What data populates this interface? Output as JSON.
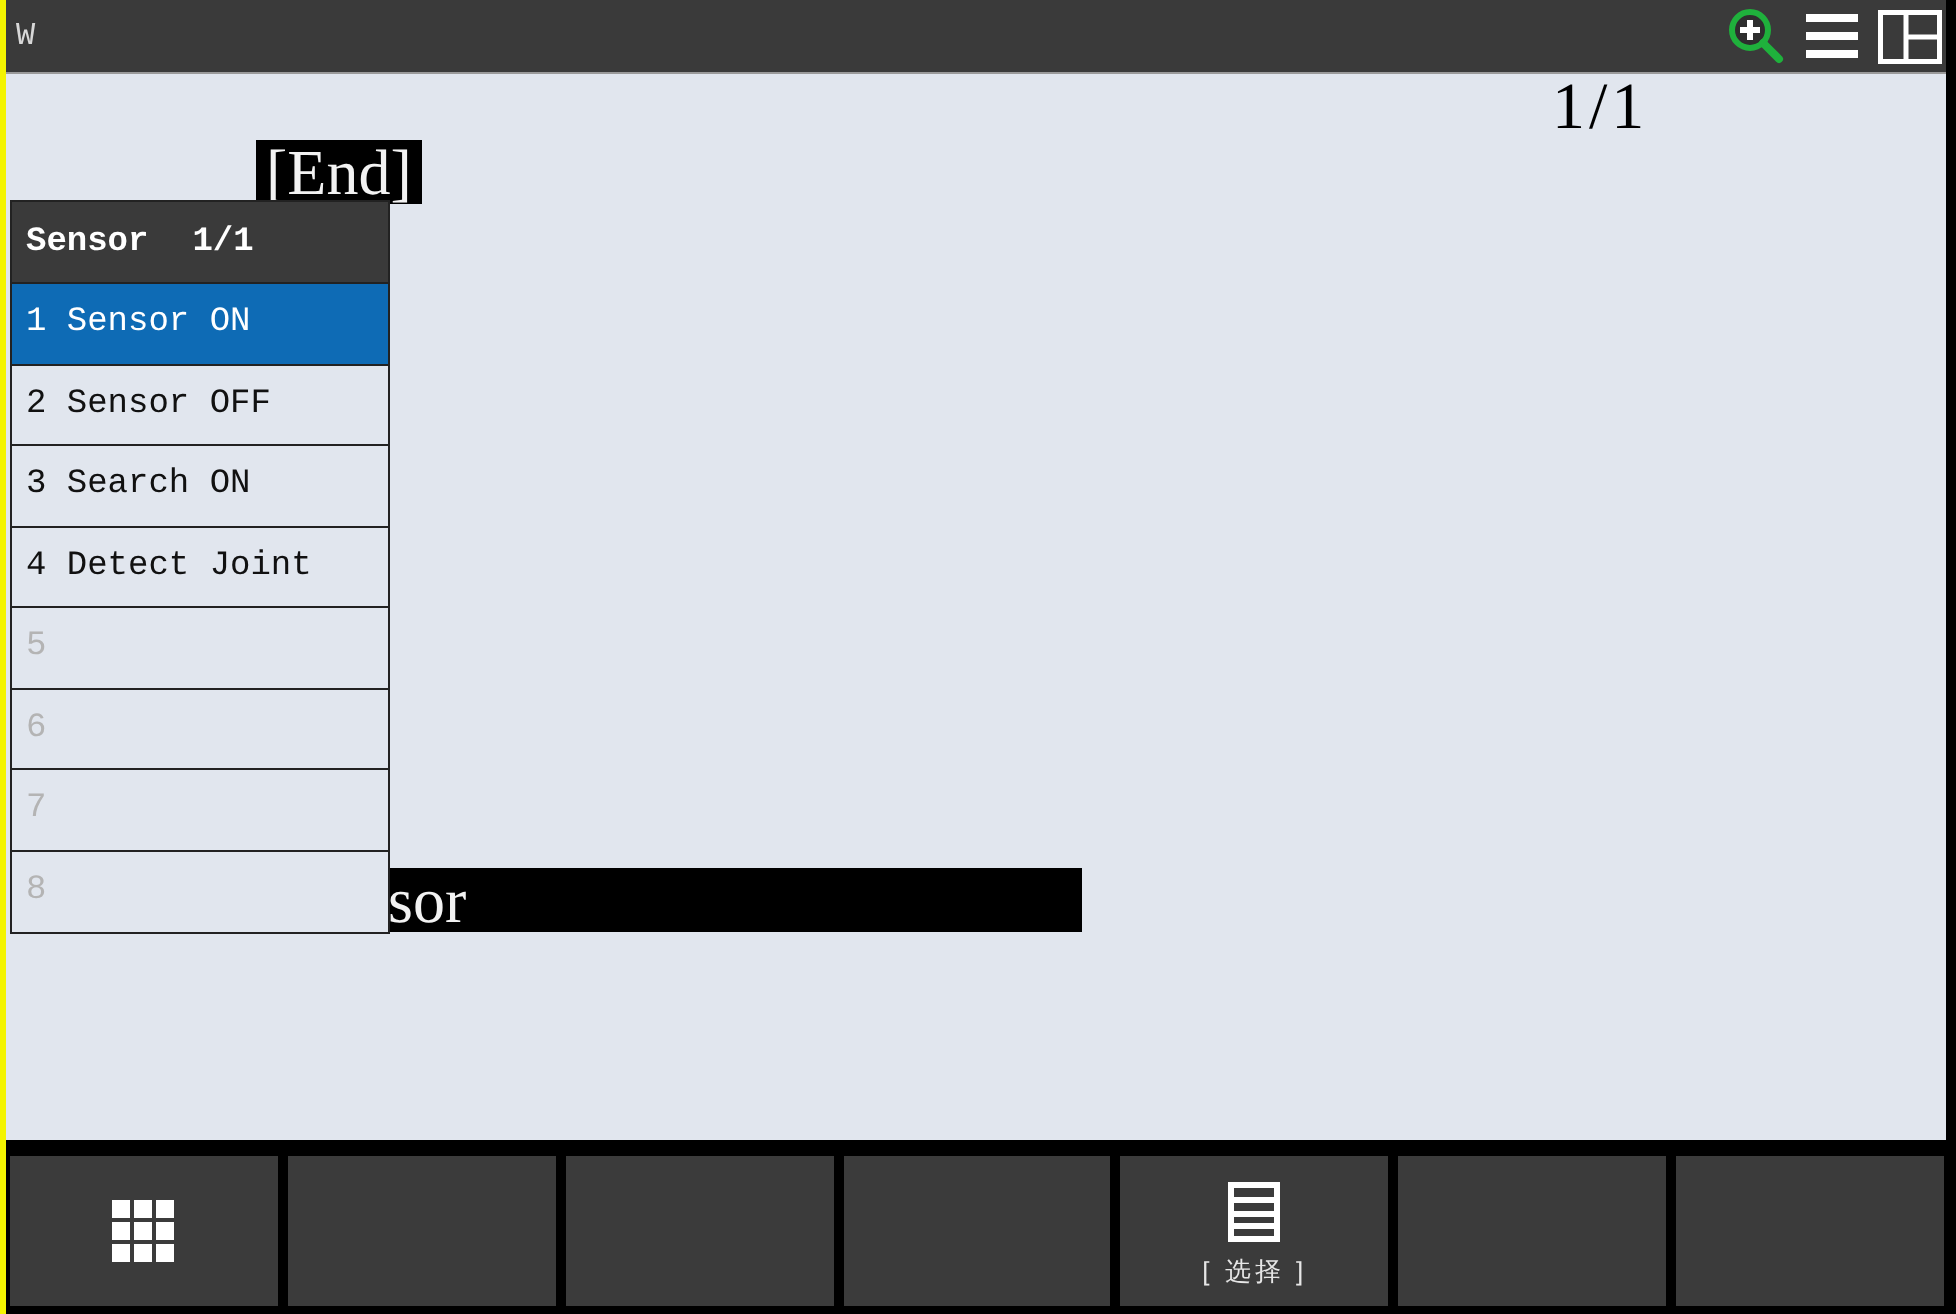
{
  "window": {
    "title": "W"
  },
  "program": {
    "page": "1/1",
    "end_marker": "[End]",
    "selected_line": "sor"
  },
  "popup_menu": {
    "title": "Sensor",
    "page": "1/1",
    "items": [
      {
        "label": "1 Sensor ON",
        "selected": true,
        "disabled": false
      },
      {
        "label": "2 Sensor OFF",
        "selected": false,
        "disabled": false
      },
      {
        "label": "3 Search ON",
        "selected": false,
        "disabled": false
      },
      {
        "label": "4 Detect Joint",
        "selected": false,
        "disabled": false
      },
      {
        "label": "5",
        "selected": false,
        "disabled": true
      },
      {
        "label": "6",
        "selected": false,
        "disabled": true
      },
      {
        "label": "7",
        "selected": false,
        "disabled": true
      },
      {
        "label": "8",
        "selected": false,
        "disabled": true
      }
    ]
  },
  "function_keys": [
    {
      "kind": "menu"
    },
    {
      "kind": "blank"
    },
    {
      "kind": "blank"
    },
    {
      "kind": "blank"
    },
    {
      "kind": "action",
      "label": "[ 选择 ]"
    },
    {
      "kind": "blank"
    },
    {
      "kind": "blank"
    }
  ]
}
